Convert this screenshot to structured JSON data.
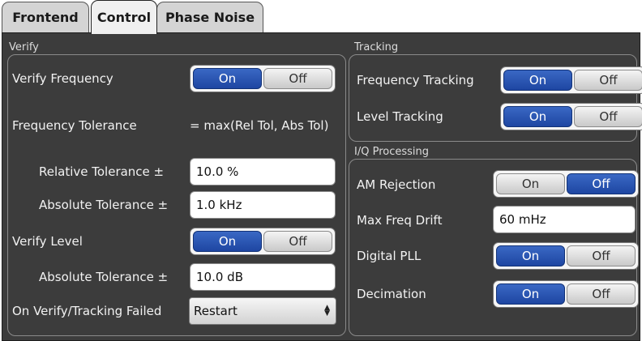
{
  "tabs": [
    {
      "label": "Frontend"
    },
    {
      "label": "Control"
    },
    {
      "label": "Phase Noise"
    }
  ],
  "verify": {
    "title": "Verify",
    "verify_frequency": {
      "label": "Verify Frequency",
      "on": "On",
      "off": "Off",
      "selected": "On"
    },
    "frequency_tolerance": {
      "label": "Frequency Tolerance",
      "value": "= max(Rel Tol, Abs Tol)"
    },
    "relative_tolerance": {
      "label": "Relative Tolerance ±",
      "value": "10.0 %"
    },
    "absolute_tolerance_freq": {
      "label": "Absolute Tolerance ±",
      "value": "1.0 kHz"
    },
    "verify_level": {
      "label": "Verify Level",
      "on": "On",
      "off": "Off",
      "selected": "On"
    },
    "absolute_tolerance_level": {
      "label": "Absolute Tolerance ±",
      "value": "10.0 dB"
    },
    "on_failed": {
      "label": "On Verify/Tracking Failed",
      "value": "Restart"
    }
  },
  "tracking": {
    "title": "Tracking",
    "frequency_tracking": {
      "label": "Frequency Tracking",
      "on": "On",
      "off": "Off",
      "selected": "On"
    },
    "level_tracking": {
      "label": "Level Tracking",
      "on": "On",
      "off": "Off",
      "selected": "On"
    }
  },
  "iq": {
    "title": "I/Q Processing",
    "am_rejection": {
      "label": "AM Rejection",
      "on": "On",
      "off": "Off",
      "selected": "Off"
    },
    "max_freq_drift": {
      "label": "Max Freq Drift",
      "value": "60 mHz"
    },
    "digital_pll": {
      "label": "Digital PLL",
      "on": "On",
      "off": "Off",
      "selected": "On"
    },
    "decimation": {
      "label": "Decimation",
      "on": "On",
      "off": "Off",
      "selected": "On"
    }
  },
  "colors": {
    "panel_bg": "#3c3c3c",
    "selected_blue": "#2a55b3",
    "tab_active": "#f0f0f0",
    "tab_inactive": "#d4d4d4"
  }
}
